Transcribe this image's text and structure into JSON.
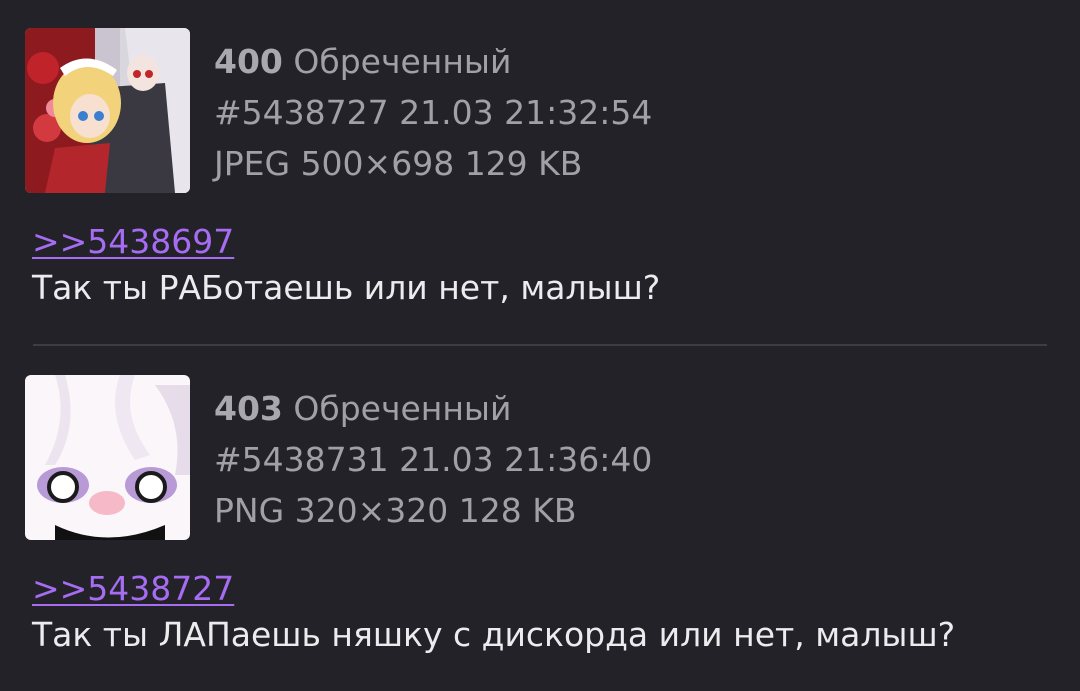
{
  "posts": [
    {
      "number": "400",
      "name": "Обреченный",
      "id": "#5438727",
      "date": "21.03",
      "time": "21:32:54",
      "file": {
        "type": "JPEG",
        "dims": "500×698",
        "size": "129 KB"
      },
      "reply_to": ">>5438697",
      "text": "Так ты РАБотаешь или нет, малыш?"
    },
    {
      "number": "403",
      "name": "Обреченный",
      "id": "#5438731",
      "date": "21.03",
      "time": "21:36:40",
      "file": {
        "type": "PNG",
        "dims": "320×320",
        "size": "128 KB"
      },
      "reply_to": ">>5438727",
      "text": "Так ты ЛАПаешь няшку с дискорда или нет, малыш?"
    }
  ],
  "colors": {
    "background": "#222228",
    "meta_text": "#a0a0a6",
    "post_text": "#ececef",
    "reply_link": "#a66cf2",
    "divider": "#3d3d45"
  }
}
